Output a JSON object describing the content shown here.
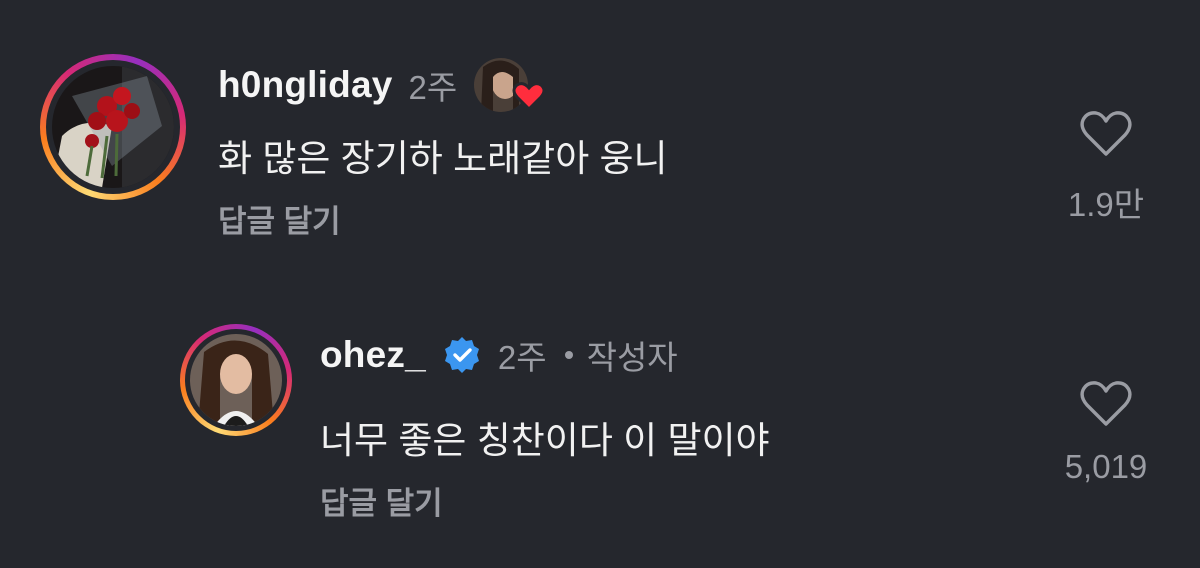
{
  "comments": [
    {
      "username": "h0ngliday",
      "time": "2주",
      "text": "화 많은 장기하 노래같아 웅니",
      "reply_label": "답글 달기",
      "like_count": "1.9만",
      "liked_by_author": true
    },
    {
      "username": "ohez_",
      "verified": true,
      "time": "2주",
      "author_tag": "작성자",
      "text": "너무 좋은 칭찬이다 이 말이야",
      "reply_label": "답글 달기",
      "like_count": "5,019"
    }
  ],
  "colors": {
    "background": "#25272d",
    "secondary_text": "#9a9ca3",
    "verified_blue": "#3b96f0",
    "heart_red": "#ff2d3d"
  }
}
